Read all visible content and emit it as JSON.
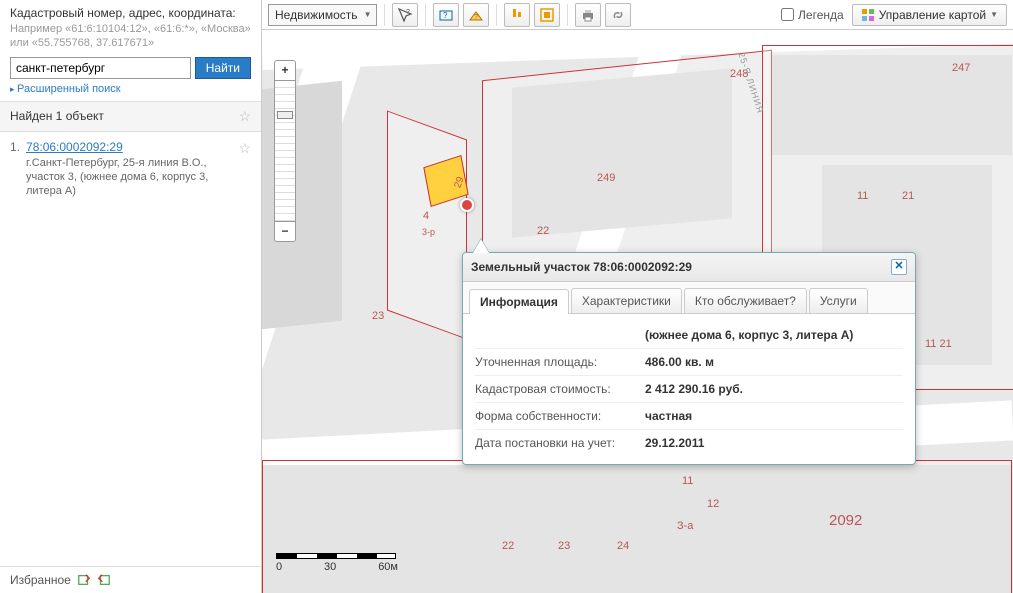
{
  "search": {
    "title": "Кадастровый номер, адрес, координата:",
    "hint": "Например «61:6:10104:12», «61:6:*», «Москва» или «55.755768, 37.617671»",
    "value": "санкт-петербург",
    "button": "Найти",
    "advanced": "Расширенный поиск"
  },
  "results": {
    "header": "Найден 1 объект",
    "items": [
      {
        "num": "1.",
        "link": "78:06:0002092:29",
        "address": "г.Санкт-Петербург, 25-я линия В.О., участок 3, (южнее дома 6, корпус 3, литера А)"
      }
    ]
  },
  "favorites": {
    "label": "Избранное"
  },
  "toolbar": {
    "dropdown": "Недвижимость",
    "legend": "Легенда",
    "mapctrl": "Управление картой"
  },
  "map": {
    "scale": {
      "v0": "0",
      "v1": "30",
      "v2": "60м"
    },
    "labels": {
      "l248": "248",
      "l247": "247",
      "l249": "249",
      "l22": "22",
      "l23": "23",
      "l11": "11",
      "l21": "21",
      "l11_21": "11 21",
      "l2092": "2092",
      "l24": "24",
      "l12": "12",
      "l3a": "З-а",
      "l4": "4",
      "l3p": "3-р",
      "l29": "29",
      "l25line": "25-Я ЛИНИЯ"
    }
  },
  "popup": {
    "title": "Земельный участок 78:06:0002092:29",
    "tabs": {
      "t1": "Информация",
      "t2": "Характеристики",
      "t3": "Кто обслуживает?",
      "t4": "Услуги"
    },
    "addr_value": "(южнее дома 6, корпус 3, литера А)",
    "rows": [
      {
        "label": "Уточненная площадь:",
        "value": "486.00 кв. м"
      },
      {
        "label": "Кадастровая стоимость:",
        "value": "2 412 290.16 руб."
      },
      {
        "label": "Форма собственности:",
        "value": "частная"
      },
      {
        "label": "Дата постановки на учет:",
        "value": "29.12.2011"
      }
    ]
  }
}
